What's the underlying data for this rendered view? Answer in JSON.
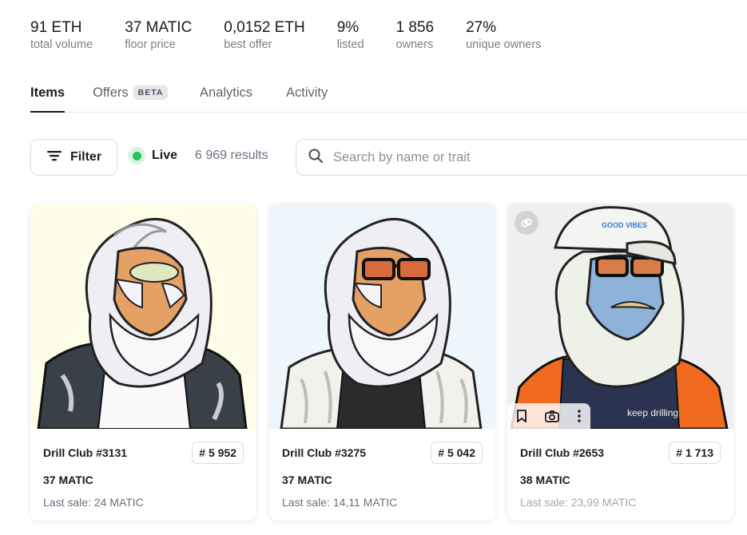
{
  "stats": [
    {
      "value": "91 ETH",
      "label": "total volume"
    },
    {
      "value": "37 MATIC",
      "label": "floor price"
    },
    {
      "value": "0,0152 ETH",
      "label": "best offer"
    },
    {
      "value": "9%",
      "label": "listed"
    },
    {
      "value": "1 856",
      "label": "owners"
    },
    {
      "value": "27%",
      "label": "unique owners"
    }
  ],
  "tabs": [
    {
      "label": "Items",
      "active": true
    },
    {
      "label": "Offers",
      "badge": "BETA"
    },
    {
      "label": "Analytics"
    },
    {
      "label": "Activity"
    }
  ],
  "toolbar": {
    "filter_label": "Filter",
    "live_label": "Live",
    "results": "6 969 results",
    "search_placeholder": "Search by name or trait"
  },
  "cards": [
    {
      "name": "Drill Club #3131",
      "rank": "# 5 952",
      "price": "37 MATIC",
      "last_sale": "Last sale: 24 MATIC",
      "bg": "#fdfde8"
    },
    {
      "name": "Drill Club #3275",
      "rank": "# 5 042",
      "price": "37 MATIC",
      "last_sale": "Last sale: 14,11 MATIC",
      "bg": "#eef5fb"
    },
    {
      "name": "Drill Club #2653",
      "rank": "# 1 713",
      "price": "38 MATIC",
      "last_sale": "Last sale: 23,99 MATIC",
      "bg": "#efefef",
      "cap_text": "GOOD VIBES",
      "shirt_text": "keep drilling"
    }
  ],
  "colors": {
    "live": "#22c55e",
    "accent": "#1a1a22"
  }
}
